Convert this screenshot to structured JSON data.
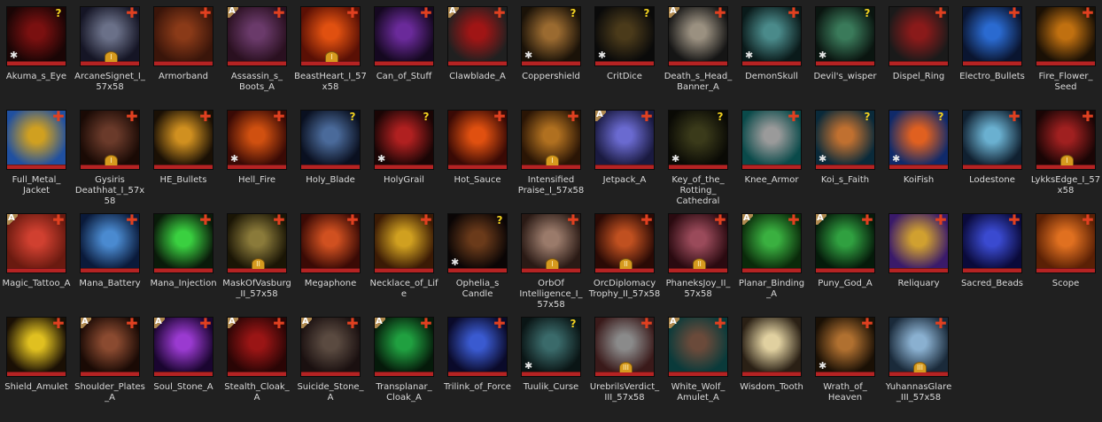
{
  "items": [
    {
      "name": "Akuma_s_Eye",
      "badge": "q",
      "a": false,
      "star": true,
      "coin": "",
      "c1": "#7a1010",
      "c2": "#1a0505"
    },
    {
      "name": "ArcaneSignet_I_\n57x58",
      "badge": "plus",
      "a": false,
      "star": false,
      "coin": "I",
      "c1": "#6a7088",
      "c2": "#151525"
    },
    {
      "name": "Armorband",
      "badge": "plus",
      "a": false,
      "star": false,
      "coin": "",
      "c1": "#8a3a18",
      "c2": "#3a150a"
    },
    {
      "name": "Assassin_s_\nBoots_A",
      "badge": "plus",
      "a": true,
      "star": false,
      "coin": "",
      "c1": "#6a3a6a",
      "c2": "#2a1020"
    },
    {
      "name": "BeastHeart_I_57\nx58",
      "badge": "plus",
      "a": false,
      "star": false,
      "coin": "I",
      "c1": "#e05010",
      "c2": "#5a1005"
    },
    {
      "name": "Can_of_Stuff",
      "badge": "plus",
      "a": false,
      "star": false,
      "coin": "",
      "c1": "#6a2a9a",
      "c2": "#150820"
    },
    {
      "name": "Clawblade_A",
      "badge": "plus",
      "a": true,
      "star": false,
      "coin": "",
      "c1": "#a01515",
      "c2": "#202020"
    },
    {
      "name": "Coppershield",
      "badge": "q",
      "a": false,
      "star": true,
      "coin": "",
      "c1": "#9a6a30",
      "c2": "#1a1208"
    },
    {
      "name": "CritDice",
      "badge": "q",
      "a": false,
      "star": true,
      "coin": "",
      "c1": "#4a3a1a",
      "c2": "#0a0a0a"
    },
    {
      "name": "Death_s_Head_\nBanner_A",
      "badge": "plus",
      "a": true,
      "star": false,
      "coin": "",
      "c1": "#9a9080",
      "c2": "#151515"
    },
    {
      "name": "DemonSkull",
      "badge": "plus",
      "a": false,
      "star": true,
      "coin": "",
      "c1": "#4a8a8a",
      "c2": "#0a1a1a"
    },
    {
      "name": "Devil's_wisper",
      "badge": "q",
      "a": false,
      "star": true,
      "coin": "",
      "c1": "#3a7a5a",
      "c2": "#0a1510"
    },
    {
      "name": "Dispel_Ring",
      "badge": "plus",
      "a": false,
      "star": false,
      "coin": "",
      "c1": "#8a1a1a",
      "c2": "#1a1a1a"
    },
    {
      "name": "Electro_Bullets",
      "badge": "plus",
      "a": false,
      "star": false,
      "coin": "",
      "c1": "#2a6ad0",
      "c2": "#0a1530"
    },
    {
      "name": "Fire_Flower_\nSeed",
      "badge": "plus",
      "a": false,
      "star": false,
      "coin": "",
      "c1": "#c07010",
      "c2": "#1a1005"
    },
    {
      "name": "Full_Metal_\nJacket",
      "badge": "plus",
      "a": false,
      "star": false,
      "coin": "",
      "c1": "#d0a020",
      "c2": "#2050a0"
    },
    {
      "name": "Gysiris\nDeathhat_I_57x\n58",
      "badge": "plus",
      "a": false,
      "star": false,
      "coin": "I",
      "c1": "#6a3a2a",
      "c2": "#1a0a05"
    },
    {
      "name": "HE_Bullets",
      "badge": "plus",
      "a": false,
      "star": false,
      "coin": "",
      "c1": "#d09020",
      "c2": "#1a1005"
    },
    {
      "name": "Hell_Fire",
      "badge": "plus",
      "a": false,
      "star": true,
      "coin": "",
      "c1": "#d05010",
      "c2": "#3a0a05"
    },
    {
      "name": "Holy_Blade",
      "badge": "q",
      "a": false,
      "star": false,
      "coin": "",
      "c1": "#4a6a9a",
      "c2": "#0a1020"
    },
    {
      "name": "HolyGrail",
      "badge": "q",
      "a": false,
      "star": true,
      "coin": "",
      "c1": "#b02020",
      "c2": "#1a0505"
    },
    {
      "name": "Hot_Sauce",
      "badge": "plus",
      "a": false,
      "star": false,
      "coin": "",
      "c1": "#e05010",
      "c2": "#3a0a05"
    },
    {
      "name": "Intensified\nPraise_I_57x58",
      "badge": "plus",
      "a": false,
      "star": false,
      "coin": "I",
      "c1": "#b07020",
      "c2": "#2a1505"
    },
    {
      "name": "Jetpack_A",
      "badge": "plus",
      "a": true,
      "star": false,
      "coin": "",
      "c1": "#6a6ad0",
      "c2": "#1a1a40"
    },
    {
      "name": "Key_of_the_\nRotting_\nCathedral",
      "badge": "q",
      "a": false,
      "star": true,
      "coin": "",
      "c1": "#3a3a1a",
      "c2": "#0a0a05"
    },
    {
      "name": "Knee_Armor",
      "badge": "plus",
      "a": false,
      "star": false,
      "coin": "",
      "c1": "#9a9a9a",
      "c2": "#0a4a4a"
    },
    {
      "name": "Koi_s_Faith",
      "badge": "q",
      "a": false,
      "star": true,
      "coin": "",
      "c1": "#c07030",
      "c2": "#0a2a3a"
    },
    {
      "name": "KoiFish",
      "badge": "q",
      "a": false,
      "star": true,
      "coin": "",
      "c1": "#e06020",
      "c2": "#102a6a"
    },
    {
      "name": "Lodestone",
      "badge": "plus",
      "a": false,
      "star": false,
      "coin": "",
      "c1": "#6ab0d0",
      "c2": "#102030"
    },
    {
      "name": "LykksEdge_I_57\nx58",
      "badge": "plus",
      "a": false,
      "star": false,
      "coin": "I",
      "c1": "#a02020",
      "c2": "#1a0505"
    },
    {
      "name": "Magic_Tattoo_A",
      "badge": "plus",
      "a": true,
      "star": false,
      "coin": "",
      "c1": "#d04030",
      "c2": "#6a1a10"
    },
    {
      "name": "Mana_Battery",
      "badge": "plus",
      "a": false,
      "star": false,
      "coin": "",
      "c1": "#4a8ad0",
      "c2": "#0a1a3a"
    },
    {
      "name": "Mana_Injection",
      "badge": "plus",
      "a": false,
      "star": false,
      "coin": "",
      "c1": "#3ad040",
      "c2": "#0a1a0a"
    },
    {
      "name": "MaskOfVasburg\n_II_57x58",
      "badge": "plus",
      "a": false,
      "star": false,
      "coin": "II",
      "c1": "#8a7a3a",
      "c2": "#1a1505"
    },
    {
      "name": "Megaphone",
      "badge": "plus",
      "a": false,
      "star": false,
      "coin": "",
      "c1": "#d05020",
      "c2": "#3a0a05"
    },
    {
      "name": "Necklace_of_Life",
      "badge": "plus",
      "a": false,
      "star": false,
      "coin": "",
      "c1": "#d0a020",
      "c2": "#3a1a05"
    },
    {
      "name": "Ophelia_s\nCandle",
      "badge": "q",
      "a": false,
      "star": true,
      "coin": "",
      "c1": "#6a3a1a",
      "c2": "#0a0505"
    },
    {
      "name": "OrbOf\nIntelligence_I_\n57x58",
      "badge": "plus",
      "a": false,
      "star": false,
      "coin": "I",
      "c1": "#9a7a6a",
      "c2": "#2a1a15"
    },
    {
      "name": "OrcDiplomacy\nTrophy_II_57x58",
      "badge": "plus",
      "a": false,
      "star": false,
      "coin": "II",
      "c1": "#c05020",
      "c2": "#2a0a05"
    },
    {
      "name": "PhaneksJoy_II_\n57x58",
      "badge": "plus",
      "a": false,
      "star": false,
      "coin": "II",
      "c1": "#9a4a5a",
      "c2": "#2a0a10"
    },
    {
      "name": "Planar_Binding\n_A",
      "badge": "plus",
      "a": true,
      "star": false,
      "coin": "",
      "c1": "#3ab040",
      "c2": "#0a2a0a"
    },
    {
      "name": "Puny_God_A",
      "badge": "plus",
      "a": true,
      "star": false,
      "coin": "",
      "c1": "#30a040",
      "c2": "#051a0a"
    },
    {
      "name": "Reliquary",
      "badge": "plus",
      "a": false,
      "star": false,
      "coin": "",
      "c1": "#d0a030",
      "c2": "#3a1a6a"
    },
    {
      "name": "Sacred_Beads",
      "badge": "plus",
      "a": false,
      "star": false,
      "coin": "",
      "c1": "#3a4ad0",
      "c2": "#0a0a3a"
    },
    {
      "name": "Scope",
      "badge": "plus",
      "a": false,
      "star": false,
      "coin": "",
      "c1": "#e07020",
      "c2": "#5a2005"
    },
    {
      "name": "Shield_Amulet",
      "badge": "plus",
      "a": false,
      "star": false,
      "coin": "",
      "c1": "#e0c020",
      "c2": "#1a1005"
    },
    {
      "name": "Shoulder_Plates\n_A",
      "badge": "plus",
      "a": true,
      "star": false,
      "coin": "",
      "c1": "#8a4a30",
      "c2": "#1a0a05"
    },
    {
      "name": "Soul_Stone_A",
      "badge": "plus",
      "a": true,
      "star": false,
      "coin": "",
      "c1": "#9a3ad0",
      "c2": "#1a0530"
    },
    {
      "name": "Stealth_Cloak_\nA",
      "badge": "plus",
      "a": true,
      "star": false,
      "coin": "",
      "c1": "#9a1515",
      "c2": "#2a0505"
    },
    {
      "name": "Suicide_Stone_\nA",
      "badge": "plus",
      "a": true,
      "star": false,
      "coin": "",
      "c1": "#5a4a40",
      "c2": "#1a1010"
    },
    {
      "name": "Transplanar_\nCloak_A",
      "badge": "plus",
      "a": true,
      "star": false,
      "coin": "",
      "c1": "#20a040",
      "c2": "#051a0a"
    },
    {
      "name": "Trilink_of_Force",
      "badge": "plus",
      "a": false,
      "star": false,
      "coin": "",
      "c1": "#3a5ad0",
      "c2": "#0a0a2a"
    },
    {
      "name": "Tuulik_Curse",
      "badge": "q",
      "a": false,
      "star": true,
      "coin": "",
      "c1": "#3a6a6a",
      "c2": "#0a1515"
    },
    {
      "name": "UrebrilsVerdict_\nIII_57x58",
      "badge": "plus",
      "a": false,
      "star": false,
      "coin": "III",
      "c1": "#8a8a8a",
      "c2": "#3a1a1a"
    },
    {
      "name": "White_Wolf_\nAmulet_A",
      "badge": "plus",
      "a": true,
      "star": false,
      "coin": "",
      "c1": "#6a4a3a",
      "c2": "#0a3a3a"
    },
    {
      "name": "Wisdom_Tooth",
      "badge": "",
      "a": false,
      "star": false,
      "coin": "",
      "c1": "#e0d0a0",
      "c2": "#2a2015"
    },
    {
      "name": "Wrath_of_\nHeaven",
      "badge": "plus",
      "a": false,
      "star": true,
      "coin": "",
      "c1": "#b07030",
      "c2": "#1a1005"
    },
    {
      "name": "YuhannasGlare\n_III_57x58",
      "badge": "plus",
      "a": false,
      "star": false,
      "coin": "III",
      "c1": "#8ab0d0",
      "c2": "#1a2a3a"
    }
  ],
  "glyphs": {
    "plus": "✚",
    "q": "?",
    "star": "✱",
    "a": "A"
  },
  "colors": {
    "background": "#202020",
    "label": "#d9d9d9",
    "redbar": "#b52323",
    "plus": "#e04020",
    "question": "#f0d020"
  }
}
